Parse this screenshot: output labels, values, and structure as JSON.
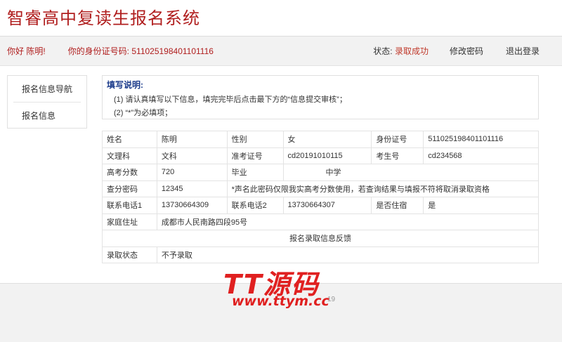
{
  "header": {
    "title": "智睿高中复读生报名系统"
  },
  "userbar": {
    "greeting": "你好 陈明!",
    "id_label": "你的身份证号码:",
    "id_value": "511025198401101116",
    "status_label": "状态:",
    "status_value": "录取成功",
    "change_password": "修改密码",
    "logout": "退出登录"
  },
  "sidebar": {
    "items": [
      {
        "label": "报名信息导航"
      },
      {
        "label": "报名信息"
      }
    ]
  },
  "notice": {
    "title": "填写说明:",
    "lines": [
      "(1) 请认真填写以下信息，填完完毕后点击最下方的“信息提交审核”；",
      "(2)  “*”为必填项；"
    ]
  },
  "form": {
    "row1": {
      "name_label": "姓名",
      "name": "陈明",
      "gender_label": "性别",
      "gender": "女",
      "id_label": "身份证号",
      "id": "511025198401101116"
    },
    "row2": {
      "track_label": "文理科",
      "track": "文科",
      "exam_no_label": "准考证号",
      "exam_no": "cd20191010115",
      "student_no_label": "考生号",
      "student_no": "cd234568"
    },
    "row3": {
      "score_label": "高考分数",
      "score": "720",
      "school_label": "毕业",
      "school": "中学"
    },
    "row4": {
      "pwd_label": "查分密码",
      "pwd": "12345",
      "note": "*声名此密码仅限我实高考分数使用，若查询结果与填报不符将取消录取资格"
    },
    "row5": {
      "phone1_label": "联系电话1",
      "phone1": "13730664309",
      "phone2_label": "联系电话2",
      "phone2": "13730664307",
      "boarding_label": "是否住宿",
      "boarding": "是"
    },
    "row6": {
      "address_label": "家庭住址",
      "address": "成都市人民南路四段95号"
    },
    "feedback_header": "报名录取信息反馈",
    "row8": {
      "admission_label": "录取状态",
      "admission": "不予录取"
    }
  },
  "footer": {
    "copyright_suffix": "19"
  },
  "watermark": {
    "main": "TT源码",
    "sub": "www.ttym.cc"
  },
  "colors": {
    "brand": "#b01e1e",
    "status": "#c0392b",
    "notice_title": "#1a3a8a"
  }
}
